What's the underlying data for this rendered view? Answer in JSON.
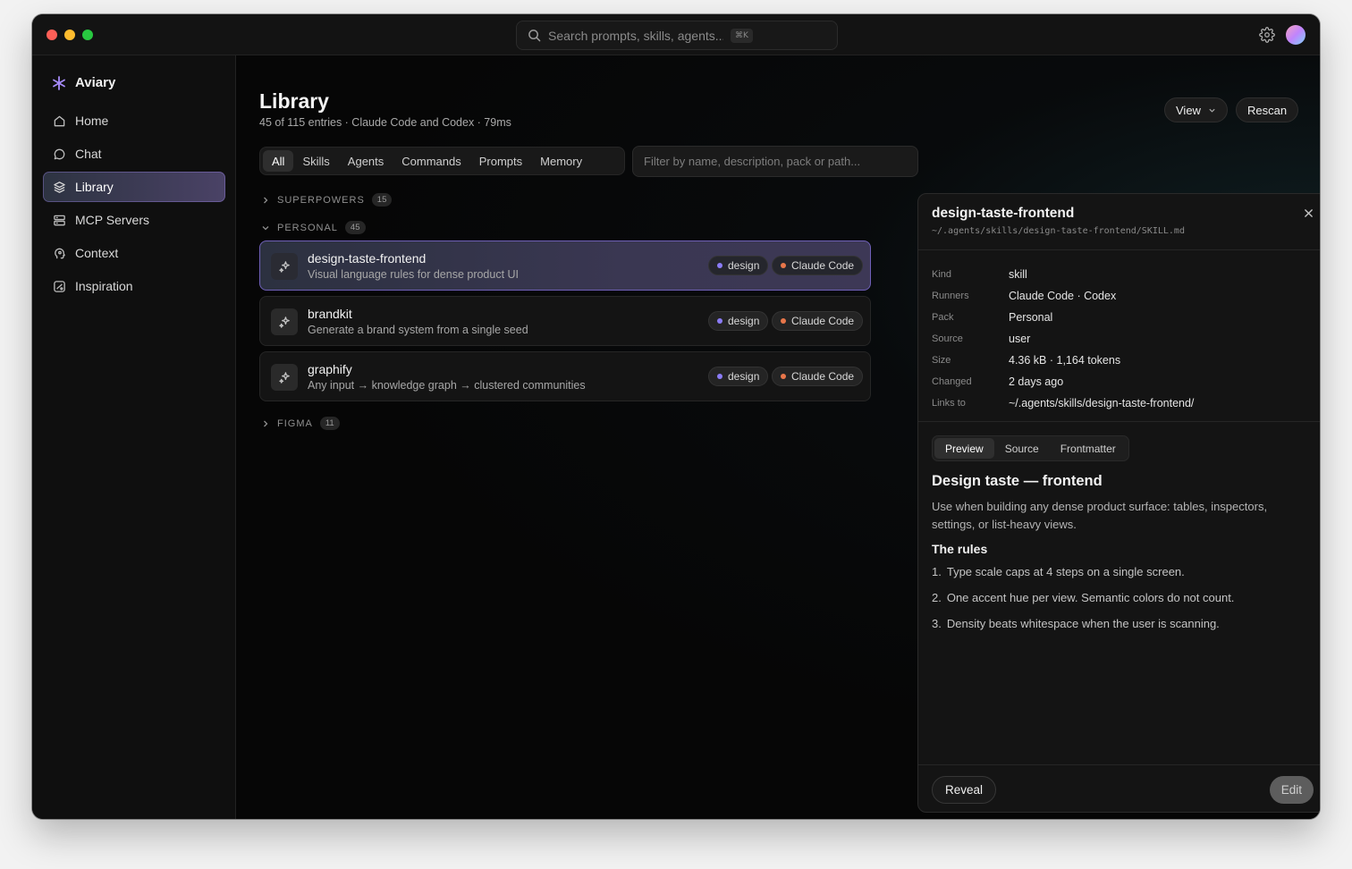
{
  "colors": {
    "accent": "#a78bfa",
    "design_dot": "#8b7cf6",
    "claude_dot": "#e8764a",
    "window_red": "#fe5f57",
    "window_yellow": "#febc2e",
    "window_green": "#28c840"
  },
  "titlebar": {
    "search_placeholder": "Search prompts, skills, agents...",
    "search_shortcut": "⌘K",
    "settings_icon": "gear-icon",
    "avatar_icon": "avatar"
  },
  "sidebar": {
    "brand": "Aviary",
    "items": [
      {
        "label": "Home",
        "icon": "home-icon"
      },
      {
        "label": "Chat",
        "icon": "chat-icon"
      },
      {
        "label": "Library",
        "icon": "layers-icon",
        "active": true
      },
      {
        "label": "MCP Servers",
        "icon": "server-icon"
      },
      {
        "label": "Context",
        "icon": "head-icon"
      },
      {
        "label": "Inspiration",
        "icon": "palette-icon"
      }
    ]
  },
  "main": {
    "title": "Library",
    "subtitle": "45 of 115 entries · Claude Code and Codex · 79ms",
    "view_label": "View",
    "rescan_label": "Rescan",
    "tabs": [
      "All",
      "Skills",
      "Agents",
      "Commands",
      "Prompts",
      "Memory"
    ],
    "active_tab": "All",
    "filter_placeholder": "Filter by name, description, pack or path...",
    "groups": [
      {
        "name": "SUPERPOWERS",
        "count": "15",
        "expanded": false
      },
      {
        "name": "PERSONAL",
        "count": "45",
        "expanded": true
      },
      {
        "name": "FIGMA",
        "count": "11",
        "expanded": false
      }
    ],
    "entries": [
      {
        "name": "design-taste-frontend",
        "description": "Visual language rules for dense product UI",
        "tags": [
          "design",
          "Claude Code"
        ],
        "selected": true
      },
      {
        "name": "brandkit",
        "description": "Generate a brand system from a single seed",
        "tags": [
          "design",
          "Claude Code"
        ],
        "selected": false
      },
      {
        "name": "graphify",
        "description": "Any input → knowledge graph → clustered communities",
        "tags": [
          "design",
          "Claude Code"
        ],
        "selected": false
      }
    ]
  },
  "inspector": {
    "title": "design-taste-frontend",
    "path": "~/.agents/skills/design-taste-frontend/SKILL.md",
    "props": [
      {
        "key": "Kind",
        "value": "skill"
      },
      {
        "key": "Runners",
        "value": "Claude Code · Codex"
      },
      {
        "key": "Pack",
        "value": "Personal"
      },
      {
        "key": "Source",
        "value": "user"
      },
      {
        "key": "Size",
        "value": "4.36 kB · 1,164 tokens"
      },
      {
        "key": "Changed",
        "value": "2 days ago"
      },
      {
        "key": "Links to",
        "value": "~/.agents/skills/design-taste-frontend/"
      }
    ],
    "tabs": [
      "Preview",
      "Source",
      "Frontmatter"
    ],
    "active_tab": "Preview",
    "doc": {
      "heading": "Design taste — frontend",
      "intro": "Use when building any dense product surface: tables, inspectors, settings, or list-heavy views.",
      "subheading": "The rules",
      "rules": [
        {
          "num": "1.",
          "text": "Type scale caps at 4 steps on a single screen."
        },
        {
          "num": "2.",
          "text": "One accent hue per view. Semantic colors do not count."
        },
        {
          "num": "3.",
          "text": "Density beats whitespace when the user is scanning."
        }
      ]
    },
    "reveal_label": "Reveal",
    "edit_label": "Edit"
  }
}
